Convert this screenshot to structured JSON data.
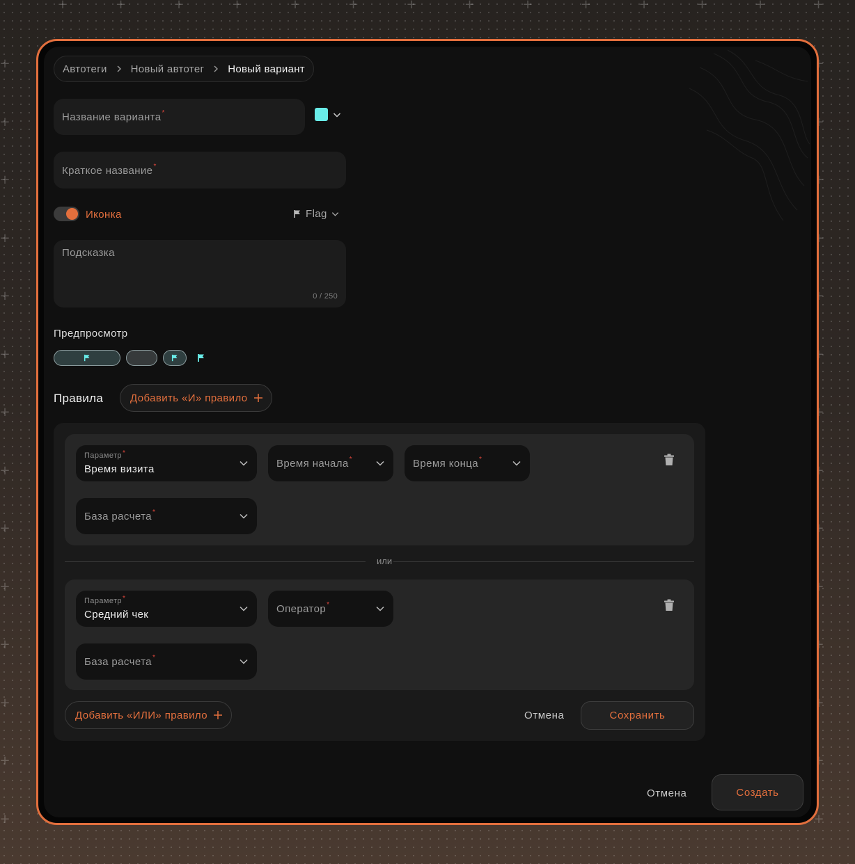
{
  "breadcrumb": {
    "items": [
      "Автотеги",
      "Новый автотег",
      "Новый вариант"
    ]
  },
  "form": {
    "variant_name_label": "Название варианта",
    "short_name_label": "Краткое название",
    "color_value": "#69ece8",
    "icon_toggle": {
      "label": "Иконка",
      "enabled": true
    },
    "icon_select": {
      "value": "Flag",
      "icon": "flag-icon"
    },
    "hint": {
      "label": "Подсказка",
      "counter": "0 / 250"
    },
    "required_mark": "*"
  },
  "preview": {
    "title": "Предпросмотр"
  },
  "rules": {
    "title": "Правила",
    "add_and_label": "Добавить «И» правило",
    "or_separator": "или",
    "groups": [
      {
        "param_label": "Параметр",
        "param_value": "Время визита",
        "start_time_label": "Время начала",
        "end_time_label": "Время конца",
        "base_label": "База расчета"
      },
      {
        "param_label": "Параметр",
        "param_value": "Средний чек",
        "operator_label": "Оператор",
        "base_label": "База расчета"
      }
    ],
    "add_or_label": "Добавить «ИЛИ» правило",
    "cancel_label": "Отмена",
    "save_label": "Сохранить"
  },
  "footer": {
    "cancel_label": "Отмена",
    "create_label": "Создать"
  },
  "colors": {
    "accent": "#e36f3d",
    "teal": "#69ece8",
    "required": "#e0473c"
  }
}
